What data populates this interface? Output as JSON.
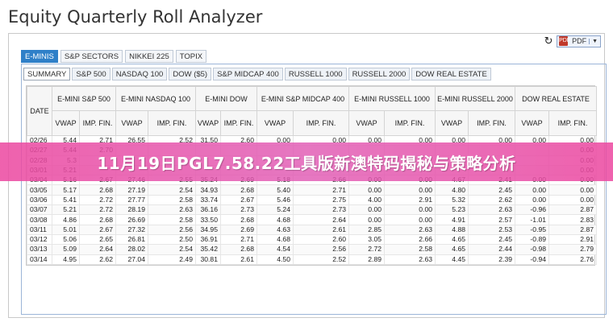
{
  "app": {
    "title": "Equity Quarterly Roll Analyzer"
  },
  "toolbar": {
    "pdf_label": "PDF",
    "pdf_icon_text": "PDF"
  },
  "outer_tabs": [
    {
      "label": "E-MINIS",
      "active": true
    },
    {
      "label": "S&P SECTORS",
      "active": false
    },
    {
      "label": "NIKKEI 225",
      "active": false
    },
    {
      "label": "TOPIX",
      "active": false
    }
  ],
  "inner_tabs": [
    {
      "label": "SUMMARY",
      "active": true
    },
    {
      "label": "S&P 500",
      "active": false
    },
    {
      "label": "NASDAQ 100",
      "active": false
    },
    {
      "label": "DOW ($5)",
      "active": false
    },
    {
      "label": "S&P MIDCAP 400",
      "active": false
    },
    {
      "label": "RUSSELL 1000",
      "active": false
    },
    {
      "label": "RUSSELL 2000",
      "active": false
    },
    {
      "label": "DOW REAL ESTATE",
      "active": false
    }
  ],
  "table": {
    "date_header": "DATE",
    "groups": [
      "E-MINI S&P 500",
      "E-MINI NASDAQ 100",
      "E-MINI DOW",
      "E-MINI S&P MIDCAP 400",
      "E-MINI RUSSELL 1000",
      "E-MINI RUSSELL 2000",
      "DOW REAL ESTATE"
    ],
    "sub_headers": [
      "VWAP",
      "IMP. FIN."
    ],
    "rows": [
      [
        "02/26",
        "5.44",
        "2.71",
        "26.55",
        "2.52",
        "31.50",
        "2.60",
        "0.00",
        "0.00",
        "0.00",
        "0.00",
        "0.00",
        "0.00",
        "0.00",
        "0.00"
      ],
      [
        "02/27",
        "5.44",
        "2.70",
        "",
        "",
        "",
        "",
        "",
        "",
        "",
        "",
        "",
        "",
        "",
        "0.00"
      ],
      [
        "02/28",
        "5.3",
        "",
        "",
        "",
        "",
        "",
        "",
        "",
        "",
        "",
        "",
        "",
        "",
        "0.00"
      ],
      [
        "03/01",
        "5.21",
        "",
        "",
        "",
        "",
        "",
        "",
        "",
        "",
        "",
        "",
        "",
        "",
        "0.00"
      ],
      [
        "03/04",
        "5.16",
        "2.67",
        "27.46",
        "2.55",
        "35.24",
        "2.69",
        "5.18",
        "2.66",
        "0.00",
        "0.00",
        "4.67",
        "2.41",
        "0.00",
        "0.00"
      ],
      [
        "03/05",
        "5.17",
        "2.68",
        "27.19",
        "2.54",
        "34.93",
        "2.68",
        "5.40",
        "2.71",
        "0.00",
        "0.00",
        "4.80",
        "2.45",
        "0.00",
        "0.00"
      ],
      [
        "03/06",
        "5.41",
        "2.72",
        "27.77",
        "2.58",
        "33.74",
        "2.67",
        "5.46",
        "2.75",
        "4.00",
        "2.91",
        "5.32",
        "2.62",
        "0.00",
        "0.00"
      ],
      [
        "03/07",
        "5.21",
        "2.72",
        "28.19",
        "2.63",
        "36.16",
        "2.73",
        "5.24",
        "2.73",
        "0.00",
        "0.00",
        "5.23",
        "2.63",
        "-0.96",
        "2.87"
      ],
      [
        "03/08",
        "4.86",
        "2.68",
        "26.69",
        "2.58",
        "33.50",
        "2.68",
        "4.68",
        "2.64",
        "0.00",
        "0.00",
        "4.91",
        "2.57",
        "-1.01",
        "2.83"
      ],
      [
        "03/11",
        "5.01",
        "2.67",
        "27.32",
        "2.56",
        "34.95",
        "2.69",
        "4.63",
        "2.61",
        "2.85",
        "2.63",
        "4.88",
        "2.53",
        "-0.95",
        "2.87"
      ],
      [
        "03/12",
        "5.06",
        "2.65",
        "26.81",
        "2.50",
        "36.91",
        "2.71",
        "4.68",
        "2.60",
        "3.05",
        "2.66",
        "4.65",
        "2.45",
        "-0.89",
        "2.91"
      ],
      [
        "03/13",
        "5.09",
        "2.64",
        "28.02",
        "2.54",
        "35.42",
        "2.68",
        "4.54",
        "2.56",
        "2.72",
        "2.58",
        "4.65",
        "2.44",
        "-0.98",
        "2.79"
      ],
      [
        "03/14",
        "4.95",
        "2.62",
        "27.04",
        "2.49",
        "30.81",
        "2.61",
        "4.50",
        "2.52",
        "2.89",
        "2.63",
        "4.45",
        "2.39",
        "-0.94",
        "2.76"
      ]
    ]
  },
  "banner": {
    "text": "11月19日PGL7.58.22工具版新澳特码揭秘与策略分析"
  }
}
